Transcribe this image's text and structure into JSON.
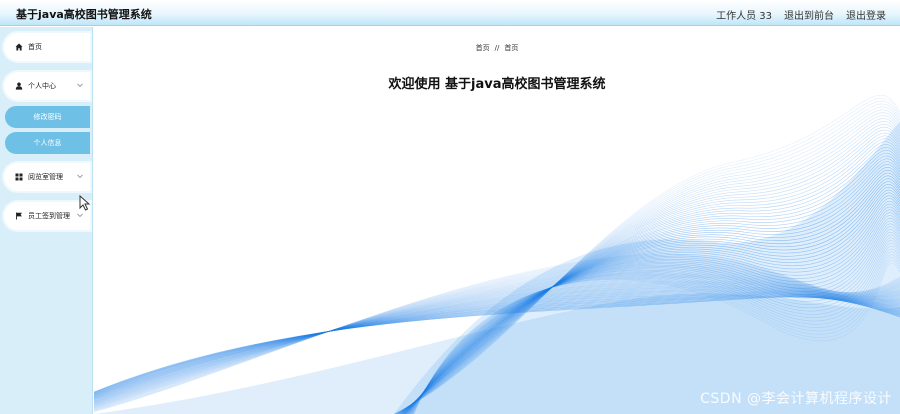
{
  "header": {
    "title": "基于java高校图书管理系统",
    "user_label": "工作人员 33",
    "to_front_label": "退出到前台",
    "logout_label": "退出登录"
  },
  "sidebar": {
    "home": {
      "label": "首页",
      "icon": "home-icon"
    },
    "personal_center": {
      "label": "个人中心",
      "icon": "user-icon",
      "children": [
        {
          "label": "修改密码"
        },
        {
          "label": "个人信息"
        }
      ]
    },
    "reading_room": {
      "label": "阅览室管理",
      "icon": "grid-icon"
    },
    "staff_signin": {
      "label": "员工签到管理",
      "icon": "flag-icon"
    }
  },
  "main": {
    "breadcrumb": {
      "root": "首页",
      "separator": "//",
      "current": "首页"
    },
    "welcome": "欢迎使用 基于java高校图书管理系统"
  },
  "watermark": "CSDN @李会计算机程序设计",
  "colors": {
    "accent": "#6ec0e6",
    "sidebar_bg": "#d8eff9",
    "wave": "#1e7fe6"
  }
}
